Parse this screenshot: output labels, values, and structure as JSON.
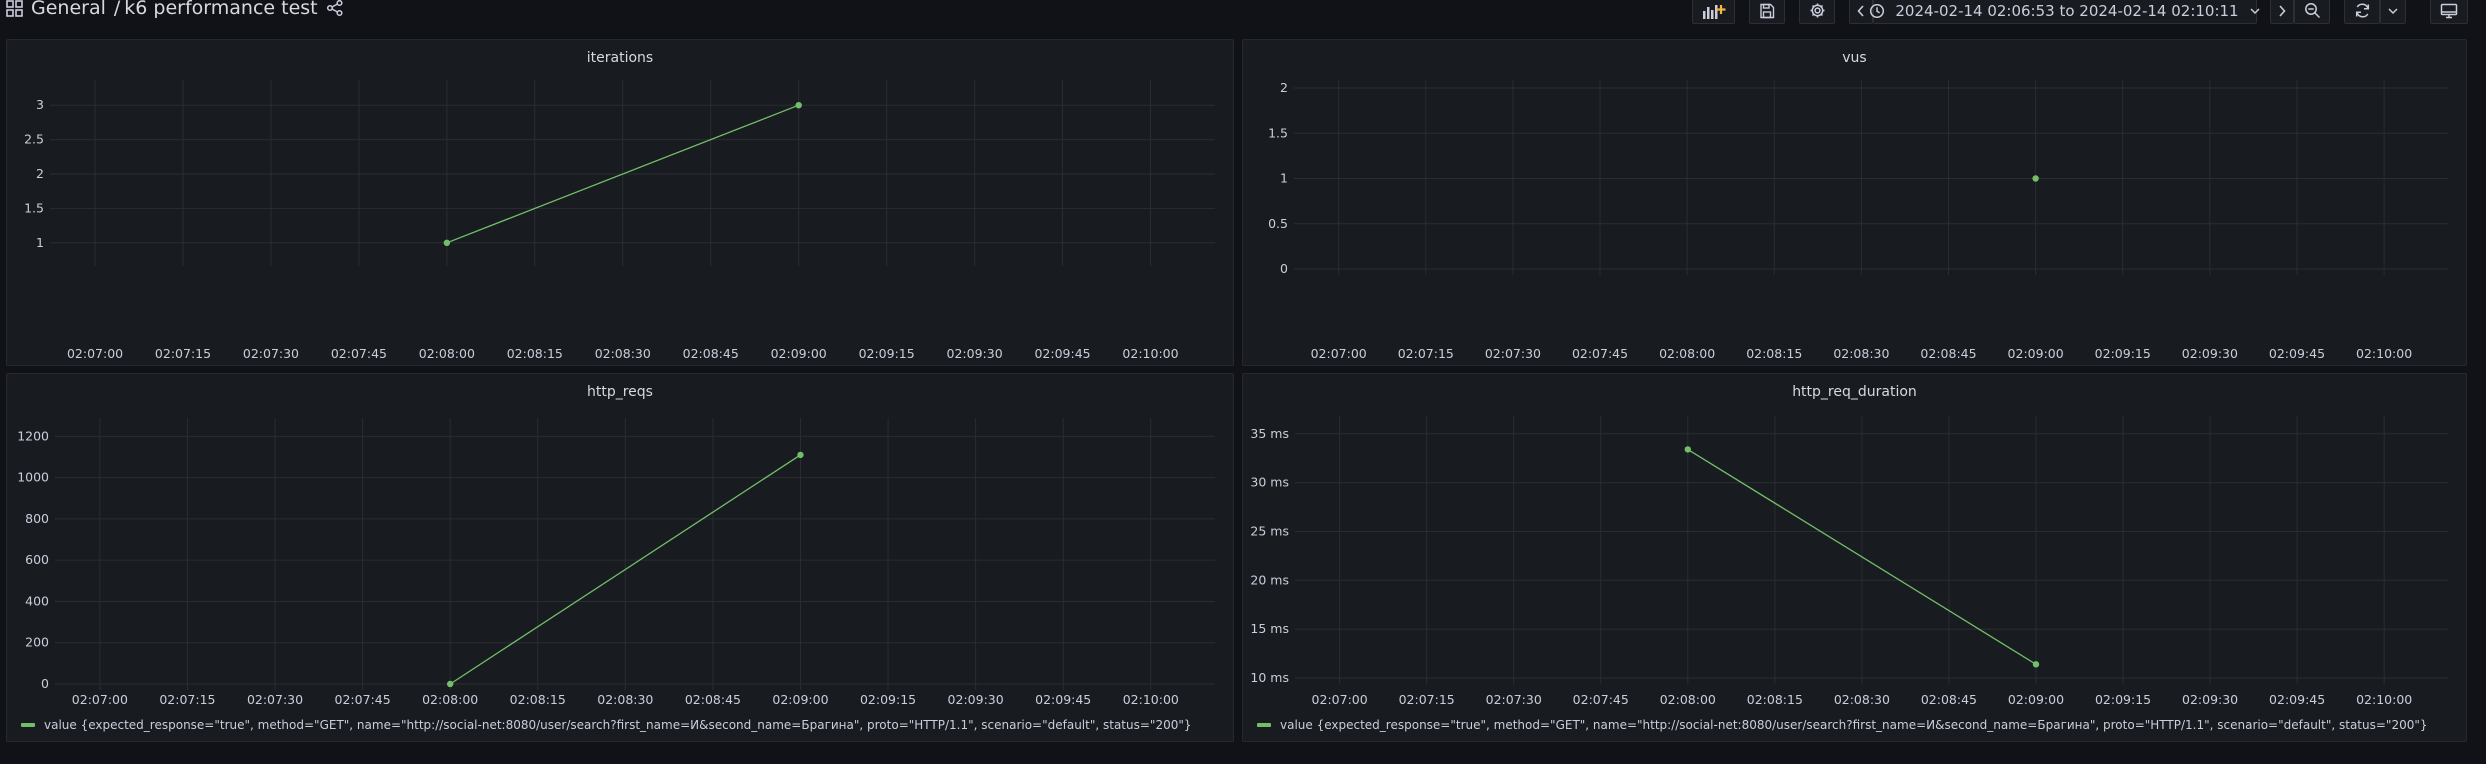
{
  "topbar": {
    "folder": "General",
    "separator": "/",
    "dashboard_title": "k6 performance test",
    "time_range": "2024-02-14 02:06:53 to 2024-02-14 02:10:11"
  },
  "colors": {
    "series": "#73bf69",
    "grid": "#2a2d33",
    "panel_bg": "#181b1f",
    "page_bg": "#111217"
  },
  "icons": [
    "dashboard-grid-icon",
    "share-icon",
    "add-panel-icon",
    "save-icon",
    "settings-icon",
    "chevron-left-icon",
    "clock-icon",
    "chevron-down-icon",
    "chevron-right-icon",
    "zoom-out-icon",
    "refresh-icon",
    "tv-mode-icon"
  ],
  "panels": [
    {
      "title": "iterations",
      "legend": ""
    },
    {
      "title": "vus",
      "legend": ""
    },
    {
      "title": "http_reqs",
      "legend": "value {expected_response=\"true\", method=\"GET\", name=\"http://social-net:8080/user/search?first_name=И&second_name=Брагина\", proto=\"HTTP/1.1\", scenario=\"default\", status=\"200\"}"
    },
    {
      "title": "http_req_duration",
      "legend": "value {expected_response=\"true\", method=\"GET\", name=\"http://social-net:8080/user/search?first_name=И&second_name=Брагина\", proto=\"HTTP/1.1\", scenario=\"default\", status=\"200\"}"
    }
  ],
  "chart_data": [
    {
      "type": "line",
      "title": "iterations",
      "x_ticks": [
        "02:07:00",
        "02:07:15",
        "02:07:30",
        "02:07:45",
        "02:08:00",
        "02:08:15",
        "02:08:30",
        "02:08:45",
        "02:09:00",
        "02:09:15",
        "02:09:30",
        "02:09:45",
        "02:10:00"
      ],
      "y_ticks": [
        "1",
        "1.5",
        "2",
        "2.5",
        "3"
      ],
      "ylim": [
        0.75,
        3.25
      ],
      "series": [
        {
          "x": [
            "02:08:00",
            "02:09:00"
          ],
          "values": [
            1,
            3
          ]
        }
      ],
      "grid": true
    },
    {
      "type": "scatter",
      "title": "vus",
      "x_ticks": [
        "02:07:00",
        "02:07:15",
        "02:07:30",
        "02:07:45",
        "02:08:00",
        "02:08:15",
        "02:08:30",
        "02:08:45",
        "02:09:00",
        "02:09:15",
        "02:09:30",
        "02:09:45",
        "02:10:00"
      ],
      "y_ticks": [
        "0",
        "0.5",
        "1",
        "1.5",
        "2"
      ],
      "ylim": [
        0,
        2
      ],
      "series": [
        {
          "x": [
            "02:09:00"
          ],
          "values": [
            1
          ]
        }
      ],
      "grid": true
    },
    {
      "type": "line",
      "title": "http_reqs",
      "x_ticks": [
        "02:07:00",
        "02:07:15",
        "02:07:30",
        "02:07:45",
        "02:08:00",
        "02:08:15",
        "02:08:30",
        "02:08:45",
        "02:09:00",
        "02:09:15",
        "02:09:30",
        "02:09:45",
        "02:10:00"
      ],
      "y_ticks": [
        "0",
        "200",
        "400",
        "600",
        "800",
        "1000",
        "1200"
      ],
      "ylim": [
        0,
        1250
      ],
      "series": [
        {
          "name": "value {expected_response=\"true\", method=\"GET\", name=\"http://social-net:8080/user/search?first_name=И&second_name=Брагина\", proto=\"HTTP/1.1\", scenario=\"default\", status=\"200\"}",
          "x": [
            "02:08:00",
            "02:09:00"
          ],
          "values": [
            0,
            1110
          ]
        }
      ],
      "grid": true,
      "legend": "bottom-left"
    },
    {
      "type": "line",
      "title": "http_req_duration",
      "x_ticks": [
        "02:07:00",
        "02:07:15",
        "02:07:30",
        "02:07:45",
        "02:08:00",
        "02:08:15",
        "02:08:30",
        "02:08:45",
        "02:09:00",
        "02:09:15",
        "02:09:30",
        "02:09:45",
        "02:10:00"
      ],
      "y_ticks": [
        "10 ms",
        "15 ms",
        "20 ms",
        "25 ms",
        "30 ms",
        "35 ms"
      ],
      "ylim": [
        10,
        36
      ],
      "y_unit": "ms",
      "series": [
        {
          "name": "value {expected_response=\"true\", method=\"GET\", name=\"http://social-net:8080/user/search?first_name=И&second_name=Брагина\", proto=\"HTTP/1.1\", scenario=\"default\", status=\"200\"}",
          "x": [
            "02:08:00",
            "02:09:00"
          ],
          "values": [
            33.4,
            11.4
          ]
        }
      ],
      "grid": true,
      "legend": "bottom-left"
    }
  ]
}
